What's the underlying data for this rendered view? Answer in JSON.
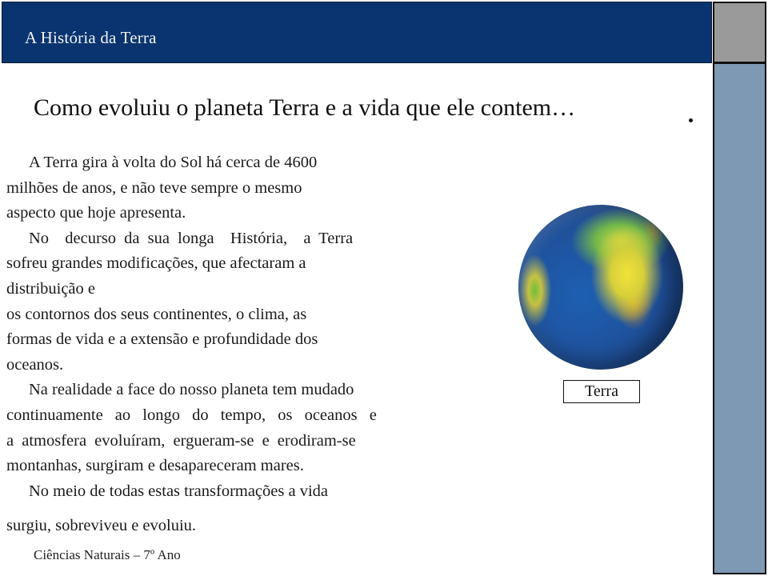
{
  "header": {
    "title": "A História da Terra"
  },
  "slide": {
    "subtitle": "Como evoluiu o planeta Terra e a vida que ele contem…",
    "paragraphs": [
      {
        "lines": [
          "A Terra gira à volta do Sol há cerca de 4600",
          "milhões de anos, e não teve sempre o mesmo",
          "aspecto que hoje apresenta."
        ]
      },
      {
        "lines": [
          "No  decurso da sua longa  História,  a Terra",
          "sofreu grandes modificações, que afectaram a",
          "distribuição e",
          "os contornos dos seus continentes, o clima, as",
          "formas de vida e a extensão e profundidade dos",
          "oceanos."
        ]
      },
      {
        "lines": [
          "Na realidade a face do nosso planeta tem mudado",
          "continuamente ao longo do tempo, os oceanos e",
          "a atmosfera evoluíram, ergueram-se e erodiram-se",
          "montanhas, surgiram e desapareceram mares."
        ]
      },
      {
        "lines": [
          "No meio de todas estas transformações a vida",
          "surgiu, sobreviveu e evoluiu."
        ]
      }
    ],
    "image": {
      "icon": "earth-globe-icon",
      "caption": "Terra"
    },
    "footer": "Ciências Naturais – 7º Ano"
  },
  "colors": {
    "title_bar": "#0a3470",
    "side_bar": "#7d99b3",
    "side_top": "#9a9a9a"
  }
}
